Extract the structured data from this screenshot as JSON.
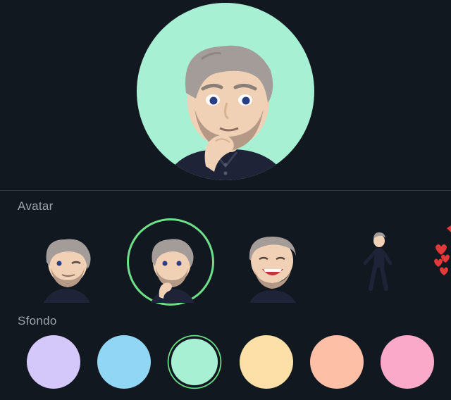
{
  "preview": {
    "background": "#a8f0d4",
    "icon": "avatar-thinking-pose"
  },
  "avatar_section": {
    "label": "Avatar",
    "items": [
      {
        "icon": "avatar-winking",
        "selected": false
      },
      {
        "icon": "avatar-thinking",
        "selected": true
      },
      {
        "icon": "avatar-laughing",
        "selected": false
      },
      {
        "icon": "avatar-full-body-dancing",
        "selected": false
      },
      {
        "icon": "hearts-sticker",
        "selected": false
      }
    ]
  },
  "background_section": {
    "label": "Sfondo",
    "swatches": [
      {
        "color": "#d4c8fb",
        "selected": false
      },
      {
        "color": "#92d6f5",
        "selected": false
      },
      {
        "color": "#a8f0d4",
        "selected": true
      },
      {
        "color": "#fde0a8",
        "selected": false
      },
      {
        "color": "#fdbfa6",
        "selected": false
      },
      {
        "color": "#fba9c8",
        "selected": false
      }
    ]
  },
  "accent_color": "#6ee08a"
}
